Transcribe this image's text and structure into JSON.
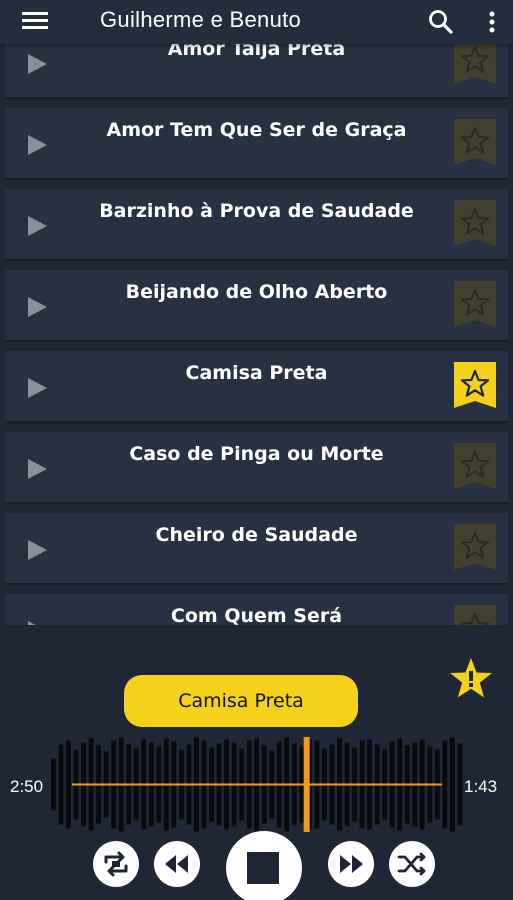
{
  "appbar": {
    "title": "Guilherme e Benuto",
    "menu_icon": "hamburger-menu-icon",
    "search_icon": "search-icon",
    "more_icon": "more-vertical-icon"
  },
  "songs": [
    {
      "title": "Amor Talja Preta",
      "favorite": false
    },
    {
      "title": "Amor Tem Que Ser de Graça",
      "favorite": false
    },
    {
      "title": "Barzinho à Prova de Saudade",
      "favorite": false
    },
    {
      "title": "Beijando de Olho Aberto",
      "favorite": false
    },
    {
      "title": "Camisa Preta",
      "favorite": true
    },
    {
      "title": "Caso de Pinga ou Morte",
      "favorite": false
    },
    {
      "title": "Cheiro de Saudade",
      "favorite": false
    },
    {
      "title": "Com Quem Será",
      "favorite": false
    }
  ],
  "player": {
    "now_playing": "Camisa Preta",
    "elapsed": "2:50",
    "remaining": "1:43",
    "progress": 0.62
  },
  "colors": {
    "accent": "#f4d21c",
    "row": "#283142",
    "background": "#1f2736",
    "progress": "#f39c12"
  }
}
